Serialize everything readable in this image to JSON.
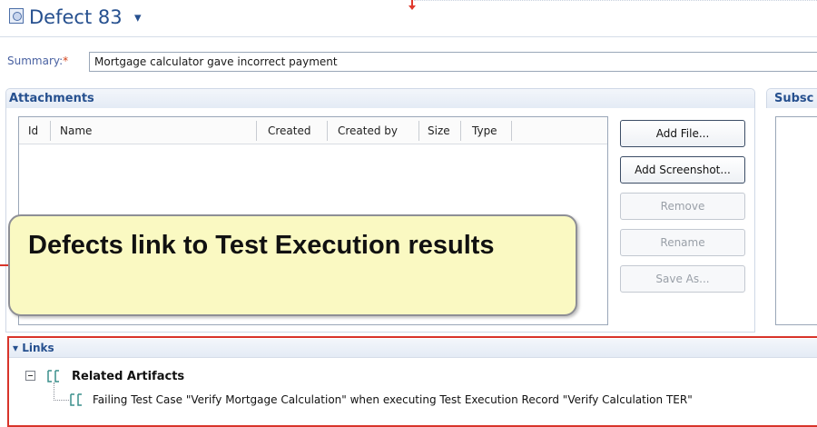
{
  "header": {
    "title": "Defect 83",
    "caret": "▾"
  },
  "summary": {
    "label": "Summary:",
    "required_marker": "*",
    "value": "Mortgage calculator gave incorrect payment"
  },
  "attachments": {
    "title": "Attachments",
    "columns": [
      "Id",
      "Name",
      "Created",
      "Created by",
      "Size",
      "Type"
    ],
    "buttons": {
      "add_file": "Add File...",
      "add_screenshot": "Add Screenshot...",
      "remove": "Remove",
      "rename": "Rename",
      "save_as": "Save As..."
    }
  },
  "subscribers": {
    "title": "Subsc"
  },
  "callout": {
    "text": "Defects link to Test Execution results"
  },
  "links": {
    "title": "Links",
    "toggle": "▾",
    "group_label": "Related Artifacts",
    "item": "Failing Test Case \"Verify Mortgage Calculation\" when executing Test Execution Record \"Verify Calculation TER\""
  },
  "colors": {
    "accent_blue": "#26508f",
    "highlight_red": "#d8342a",
    "callout_fill": "#faf9c2"
  },
  "icons": {
    "defect": "defect-icon",
    "expander": "collapse-minus-icon",
    "link_group": "link-brackets-icon",
    "link_item": "link-brackets-icon"
  }
}
